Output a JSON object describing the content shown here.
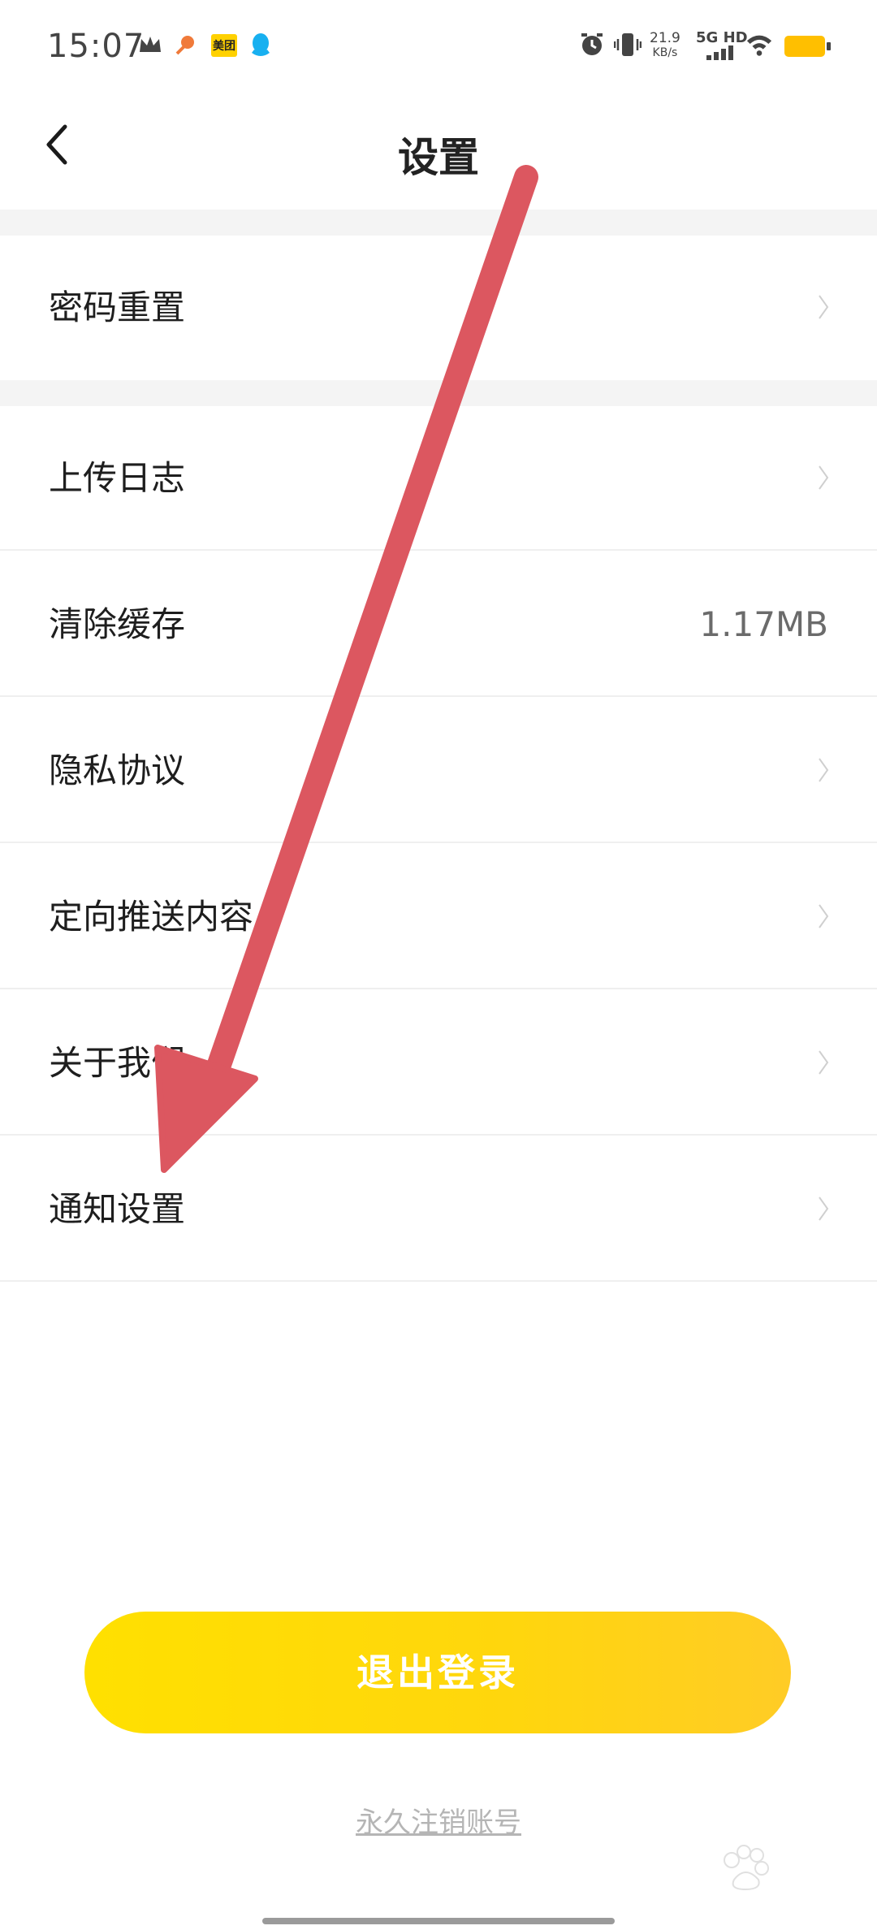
{
  "status_bar": {
    "time": "15:07",
    "meituan_badge": "美团",
    "net_speed_value": "21.9",
    "net_speed_unit": "KB/s",
    "network": "5G HD",
    "icons": [
      "crown-icon",
      "shrimp-icon",
      "meituan-icon",
      "qq-icon",
      "alarm-icon",
      "vibrate-icon",
      "signal-icon",
      "wifi-icon",
      "battery-icon"
    ],
    "battery_color": "#ffbf00"
  },
  "header": {
    "title": "设置",
    "back_icon": "chevron-left-icon"
  },
  "settings": {
    "password_reset": "密码重置",
    "upload_logs": "上传日志",
    "clear_cache": "清除缓存",
    "cache_size": "1.17MB",
    "privacy_policy": "隐私协议",
    "targeted_push": "定向推送内容",
    "about_us": "关于我们",
    "notification_settings": "通知设置"
  },
  "actions": {
    "logout": "退出登录",
    "deactivate_account": "永久注销账号"
  },
  "colors": {
    "accent_yellow": "#ffd60d",
    "annotation_arrow": "#dc5760"
  }
}
